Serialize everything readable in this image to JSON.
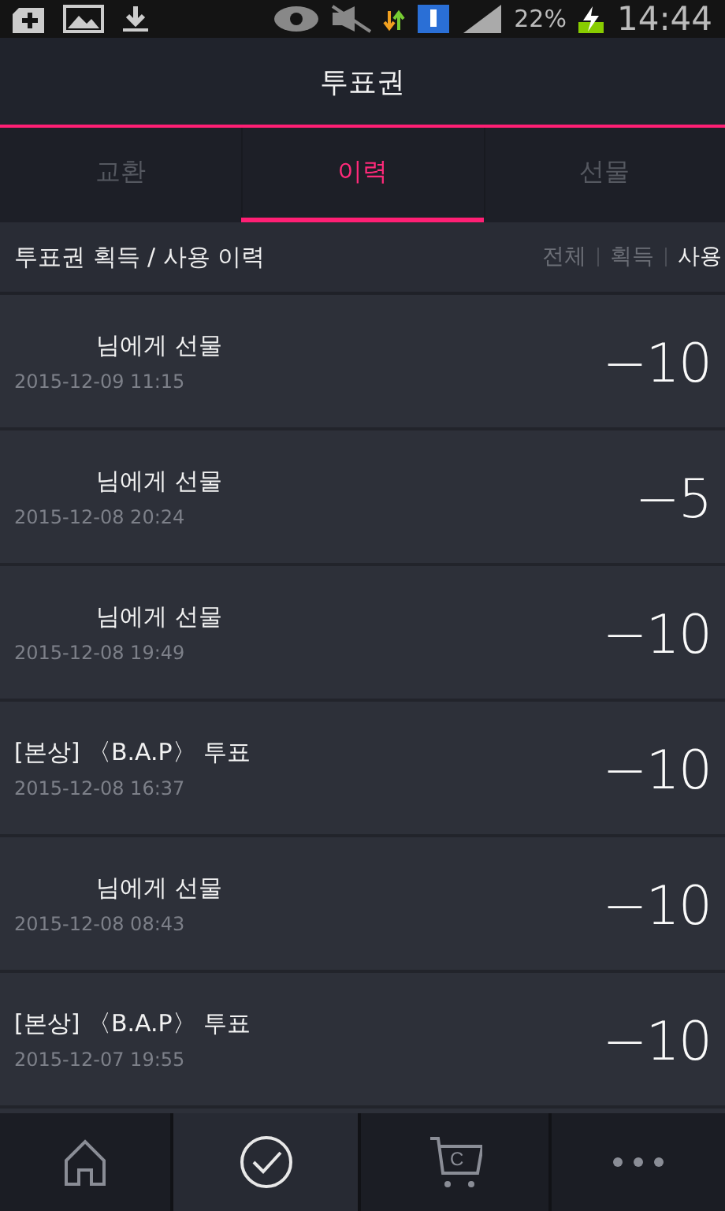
{
  "status_bar": {
    "battery": "22%",
    "time": "14:44"
  },
  "header": {
    "title": "투표권"
  },
  "tabs": [
    {
      "label": "교환",
      "selected": false
    },
    {
      "label": "이력",
      "selected": true
    },
    {
      "label": "선물",
      "selected": false
    }
  ],
  "section": {
    "title": "투표권 획득 / 사용 이력",
    "filters": [
      {
        "label": "전체",
        "selected": false
      },
      {
        "label": "획득",
        "selected": false
      },
      {
        "label": "사용",
        "selected": true
      }
    ]
  },
  "history": [
    {
      "kind": "gift",
      "title": "님에게 선물",
      "date": "2015-12-09 11:15",
      "amount": "−10"
    },
    {
      "kind": "gift",
      "title": "님에게 선물",
      "date": "2015-12-08 20:24",
      "amount": "−5"
    },
    {
      "kind": "gift",
      "title": "님에게 선물",
      "date": "2015-12-08 19:49",
      "amount": "−10"
    },
    {
      "kind": "vote",
      "title": "[본상] 〈B.A.P〉 투표",
      "date": "2015-12-08 16:37",
      "amount": "−10"
    },
    {
      "kind": "gift",
      "title": "님에게 선물",
      "date": "2015-12-08 08:43",
      "amount": "−10"
    },
    {
      "kind": "vote",
      "title": "[본상] 〈B.A.P〉 투표",
      "date": "2015-12-07 19:55",
      "amount": "−10"
    }
  ],
  "bottom_nav": [
    {
      "kind": "home",
      "selected": false
    },
    {
      "kind": "check",
      "selected": true
    },
    {
      "kind": "cart",
      "label": "C",
      "selected": false
    },
    {
      "kind": "more",
      "selected": false
    }
  ]
}
